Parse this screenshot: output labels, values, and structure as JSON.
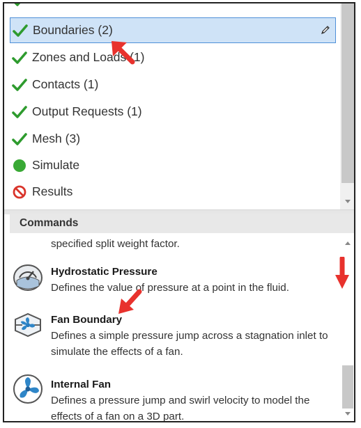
{
  "tree": {
    "items": [
      {
        "label": "Boundaries (2)",
        "status": "check-icon",
        "selected": true
      },
      {
        "label": "Zones and Loads (1)",
        "status": "check-icon",
        "selected": false
      },
      {
        "label": "Contacts (1)",
        "status": "check-icon",
        "selected": false
      },
      {
        "label": "Output Requests (1)",
        "status": "check-icon",
        "selected": false
      },
      {
        "label": "Mesh (3)",
        "status": "check-icon",
        "selected": false
      },
      {
        "label": "Simulate",
        "status": "green-circle-icon",
        "selected": false
      },
      {
        "label": "Results",
        "status": "no-entry-icon",
        "selected": false
      }
    ]
  },
  "commands": {
    "header": "Commands",
    "partial_text": "specified split weight factor.",
    "items": [
      {
        "title": "Hydrostatic Pressure",
        "description": "Defines the value of pressure at a point in the fluid.",
        "icon": "hydrostatic-pressure-icon"
      },
      {
        "title": "Fan Boundary",
        "description": "Defines a simple pressure jump across a stagnation inlet to simulate the effects of a fan.",
        "icon": "fan-boundary-icon"
      },
      {
        "title": "Internal Fan",
        "description": "Defines a pressure jump and swirl velocity to model the effects of a fan on a 3D part.",
        "icon": "internal-fan-icon"
      }
    ]
  },
  "colors": {
    "selection": "#cfe3f7",
    "selection_border": "#4e8fd8",
    "check": "#2e9b2e",
    "annotation_arrow": "#e8322d"
  }
}
